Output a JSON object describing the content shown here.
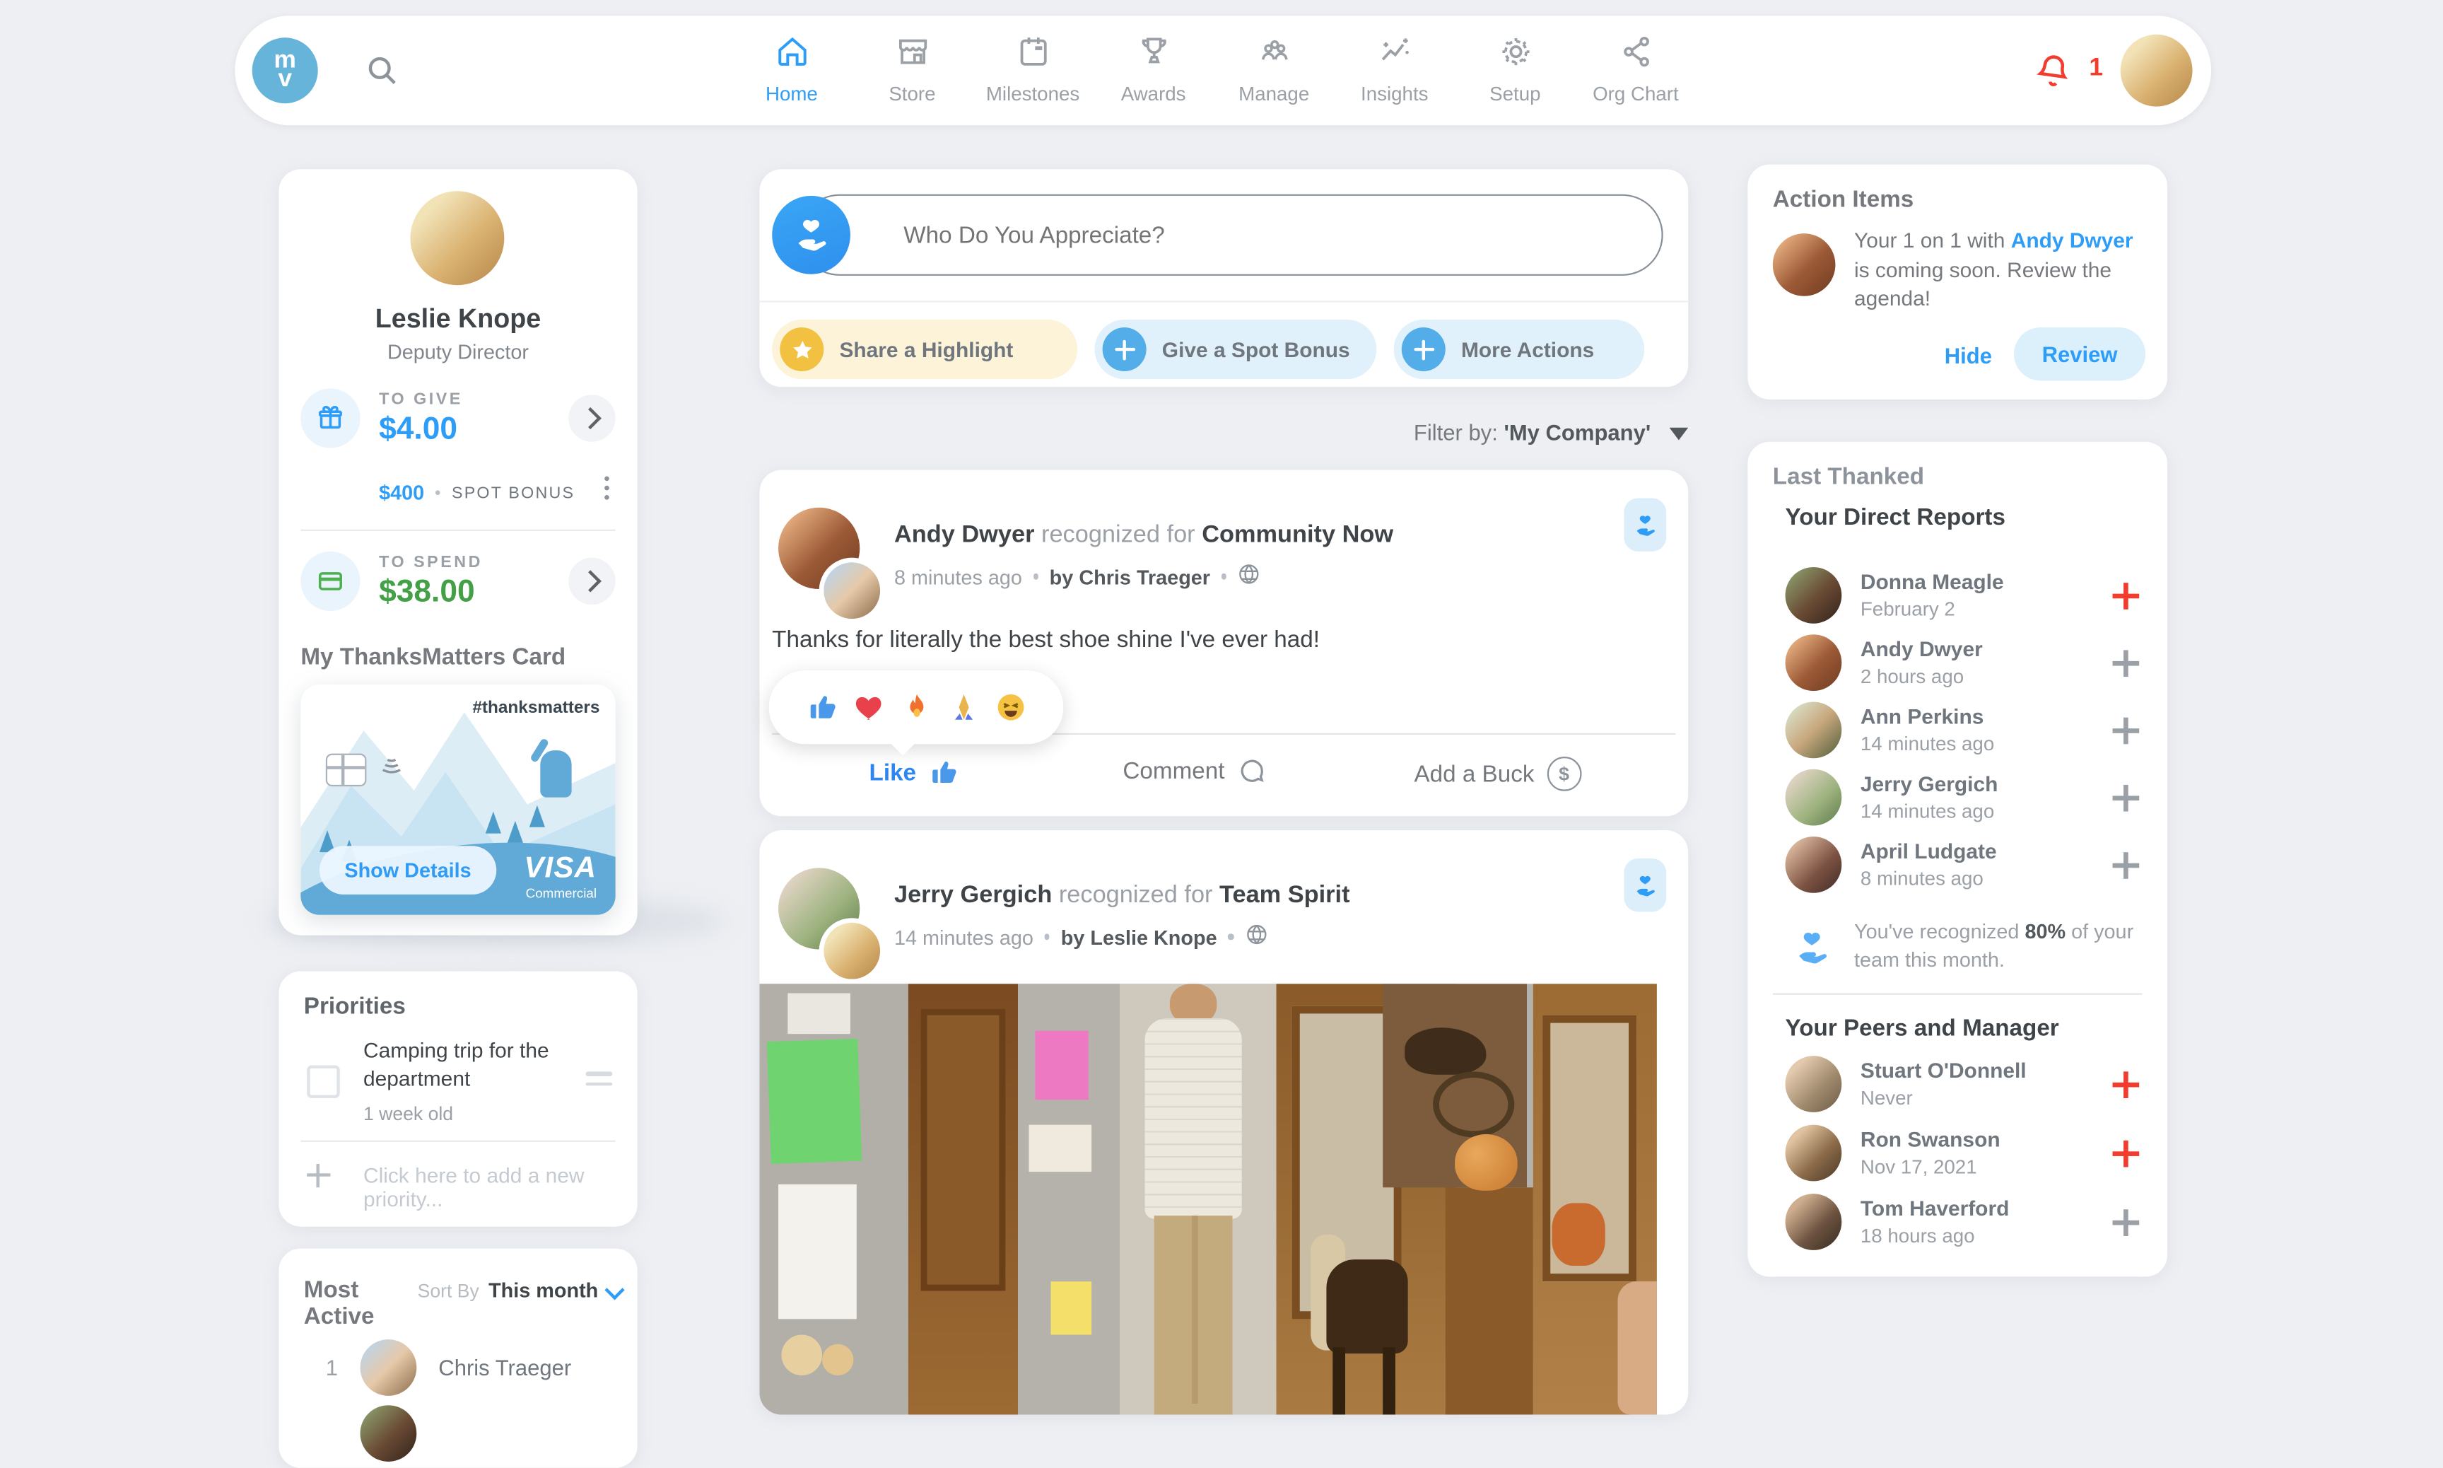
{
  "header": {
    "logo_top": "m",
    "logo_bottom": "v",
    "nav": [
      {
        "label": "Home",
        "icon": "home-icon",
        "active": true
      },
      {
        "label": "Store",
        "icon": "store-icon"
      },
      {
        "label": "Milestones",
        "icon": "calendar-icon"
      },
      {
        "label": "Awards",
        "icon": "trophy-icon"
      },
      {
        "label": "Manage",
        "icon": "people-icon"
      },
      {
        "label": "Insights",
        "icon": "insights-icon"
      },
      {
        "label": "Setup",
        "icon": "gear-icon"
      },
      {
        "label": "Org Chart",
        "icon": "share-icon"
      }
    ],
    "notification_count": "1"
  },
  "profile": {
    "name": "Leslie Knope",
    "role": "Deputy Director",
    "to_give": {
      "label": "TO GIVE",
      "amount": "$4.00"
    },
    "spot_bonus": {
      "amount": "$400",
      "label": "SPOT BONUS"
    },
    "to_spend": {
      "label": "TO SPEND",
      "amount": "$38.00"
    },
    "card_section_title": "My ThanksMatters Card",
    "card": {
      "hashtag": "#thanksmatters",
      "show_details": "Show Details",
      "brand": "VISA",
      "brand_sub": "Commercial"
    }
  },
  "priorities": {
    "title": "Priorities",
    "item": {
      "text": "Camping trip for the department",
      "age": "1 week old"
    },
    "add_placeholder": "Click here to add a new priority..."
  },
  "most_active": {
    "title": "Most Active",
    "sort_label": "Sort By",
    "sort_value": "This month",
    "items": [
      {
        "rank": "1",
        "name": "Chris Traeger"
      }
    ]
  },
  "composer": {
    "placeholder": "Who Do You Appreciate?",
    "actions": [
      {
        "label": "Share a Highlight",
        "icon": "star-icon"
      },
      {
        "label": "Give a Spot Bonus",
        "icon": "plus-icon"
      },
      {
        "label": "More Actions",
        "icon": "plus-icon"
      }
    ]
  },
  "feed": {
    "filter_prefix": "Filter by:",
    "filter_value": "'My Company'",
    "posts": [
      {
        "recipient": "Andy Dwyer",
        "connector": "recognized for",
        "value": "Community Now",
        "time": "8 minutes ago",
        "author_prefix": "by",
        "author": "Chris Traeger",
        "body": "Thanks for literally the best shoe shine I've ever had!",
        "reactions": [
          "thumbs-up",
          "heart",
          "fire",
          "praying-hands",
          "laughing"
        ],
        "actions": {
          "like": "Like",
          "comment": "Comment",
          "add_buck": "Add a Buck"
        }
      },
      {
        "recipient": "Jerry Gergich",
        "connector": "recognized for",
        "value": "Team Spirit",
        "time": "14 minutes ago",
        "author_prefix": "by",
        "author": "Leslie Knope"
      }
    ]
  },
  "action_items": {
    "title": "Action Items",
    "text_before": "Your 1 on 1 with ",
    "person": "Andy Dwyer",
    "text_after": " is coming soon. Review the agenda!",
    "hide_label": "Hide",
    "review_label": "Review"
  },
  "last_thanked": {
    "title": "Last Thanked",
    "direct_reports_title": "Your Direct Reports",
    "direct_reports": [
      {
        "name": "Donna Meagle",
        "time": "February 2",
        "highlight": true
      },
      {
        "name": "Andy Dwyer",
        "time": "2 hours ago"
      },
      {
        "name": "Ann Perkins",
        "time": "14 minutes ago"
      },
      {
        "name": "Jerry Gergich",
        "time": "14 minutes ago"
      },
      {
        "name": "April Ludgate",
        "time": "8 minutes ago"
      }
    ],
    "note_before": "You've recognized ",
    "note_bold": "80%",
    "note_after": " of your team this month.",
    "peers_title": "Your Peers and Manager",
    "peers": [
      {
        "name": "Stuart O'Donnell",
        "time": "Never",
        "highlight": true
      },
      {
        "name": "Ron Swanson",
        "time": "Nov 17, 2021",
        "highlight": true
      },
      {
        "name": "Tom Haverford",
        "time": "18 hours ago"
      }
    ]
  },
  "icons": {
    "dollar": "$"
  },
  "colors": {
    "accent": "#2e9df7",
    "green": "#43a047",
    "red": "#f23d2e",
    "yellow": "#f2c142",
    "logo_blue": "#66b4d9"
  }
}
